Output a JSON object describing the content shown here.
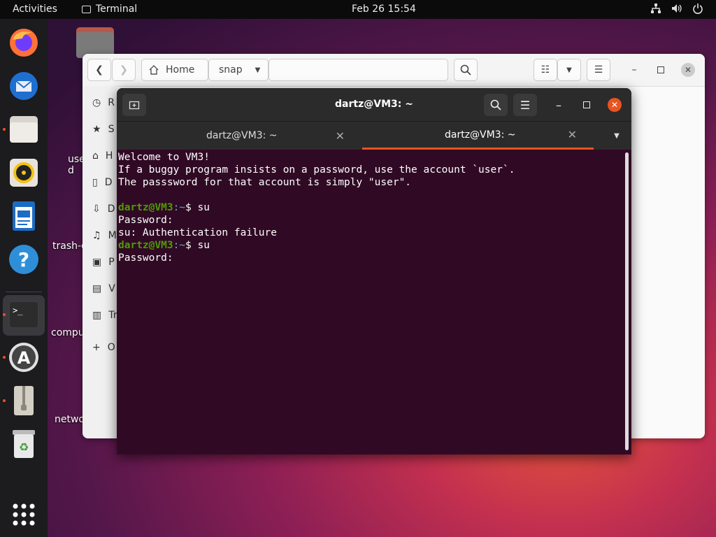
{
  "topbar": {
    "activities": "Activities",
    "app_name": "Terminal",
    "clock": "Feb 26  15:54",
    "tray_icons": [
      "network-icon",
      "volume-icon",
      "power-icon"
    ]
  },
  "dock": {
    "items": [
      "firefox",
      "thunderbird",
      "files",
      "rhythmbox",
      "libreoffice-writer",
      "help",
      "terminal",
      "software",
      "archive",
      "trash",
      "app-grid"
    ]
  },
  "desktop": {
    "items": [
      {
        "label": "use\nd"
      },
      {
        "label": "trash-c"
      },
      {
        "label": "compu"
      },
      {
        "label": "netwo"
      }
    ]
  },
  "files": {
    "path_home": "Home",
    "path_current": "snap",
    "sidebar": [
      {
        "icon": "recent-icon",
        "label": "R"
      },
      {
        "icon": "star-icon",
        "label": "S"
      },
      {
        "icon": "home-icon",
        "label": "H"
      },
      {
        "icon": "document-icon",
        "label": "D"
      },
      {
        "icon": "download-icon",
        "label": "D"
      },
      {
        "icon": "music-icon",
        "label": "M"
      },
      {
        "icon": "pictures-icon",
        "label": "P"
      },
      {
        "icon": "video-icon",
        "label": "V"
      },
      {
        "icon": "trash-icon",
        "label": "Tr"
      },
      {
        "icon": "plus-icon",
        "label": "O"
      }
    ]
  },
  "terminal": {
    "title": "dartz@VM3: ~",
    "tabs": [
      {
        "label": "dartz@VM3: ~",
        "active": false
      },
      {
        "label": "dartz@VM3: ~",
        "active": true
      }
    ],
    "lines": [
      {
        "type": "text",
        "text": "Welcome to VM3!"
      },
      {
        "type": "text",
        "text": "If a buggy program insists on a password, use the account `user`."
      },
      {
        "type": "text",
        "text": "The passsword for that account is simply \"user\"."
      },
      {
        "type": "text",
        "text": ""
      },
      {
        "type": "prompt",
        "user": "dartz@VM3",
        "path": ":~",
        "cmd": "$ su"
      },
      {
        "type": "text",
        "text": "Password:"
      },
      {
        "type": "text",
        "text": "su: Authentication failure"
      },
      {
        "type": "prompt",
        "user": "dartz@VM3",
        "path": ":~",
        "cmd": "$ su"
      },
      {
        "type": "text",
        "text": "Password:"
      }
    ]
  },
  "colors": {
    "accent": "#e95420",
    "terminal_bg": "#300a24",
    "prompt_green": "#4e9a06"
  }
}
